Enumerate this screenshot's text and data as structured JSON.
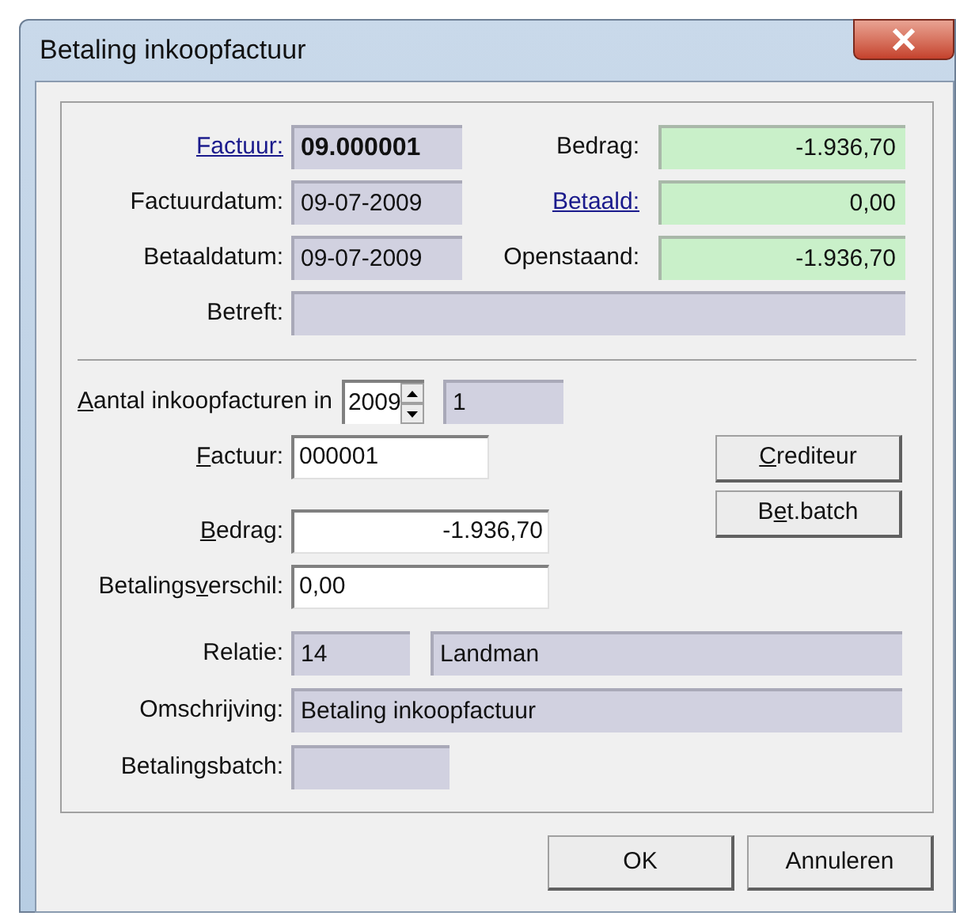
{
  "window": {
    "title": "Betaling inkoopfactuur"
  },
  "invoice": {
    "rows": [
      {
        "left": {
          "label": "Factuur:",
          "link": true,
          "value": "09.000001",
          "bold": true
        },
        "right": {
          "label": "Bedrag:",
          "link": false,
          "value": "-1.936,70"
        }
      },
      {
        "left": {
          "label": "Factuurdatum:",
          "link": false,
          "value": "09-07-2009",
          "bold": false
        },
        "right": {
          "label": "Betaald:",
          "link": true,
          "value": "0,00"
        }
      },
      {
        "left": {
          "label": "Betaaldatum:",
          "link": false,
          "value": "09-07-2009",
          "bold": false
        },
        "right": {
          "label": "Openstaand:",
          "link": false,
          "value": "-1.936,70"
        }
      }
    ],
    "betreft": {
      "label": "Betreft:"
    }
  },
  "count": {
    "label": {
      "key": "A",
      "after": "antal inkoopfacturen in"
    },
    "year": "2009",
    "result": "1"
  },
  "fields": [
    {
      "label": {
        "key": "F",
        "after": "actuur:"
      },
      "value": "000001",
      "kind": "text"
    },
    {
      "label": {
        "key": "B",
        "after": "edrag:"
      },
      "value": "-1.936,70",
      "kind": "amount"
    },
    {
      "label": {
        "before": "Betalings",
        "key": "v",
        "after": "erschil:"
      },
      "value": "0,00",
      "kind": "text"
    }
  ],
  "side_buttons": [
    {
      "key": "C",
      "after": "rediteur"
    },
    {
      "before": "B",
      "key": "e",
      "after": "t.batch"
    }
  ],
  "details": {
    "relatie": {
      "label": "Relatie:",
      "number": "14",
      "name": "Landman"
    },
    "omschrijving": {
      "label": "Omschrijving:",
      "value": "Betaling inkoopfactuur"
    },
    "betalingsbatch": {
      "label": "Betalingsbatch:"
    }
  },
  "footer_buttons": [
    "OK",
    "Annuleren"
  ]
}
